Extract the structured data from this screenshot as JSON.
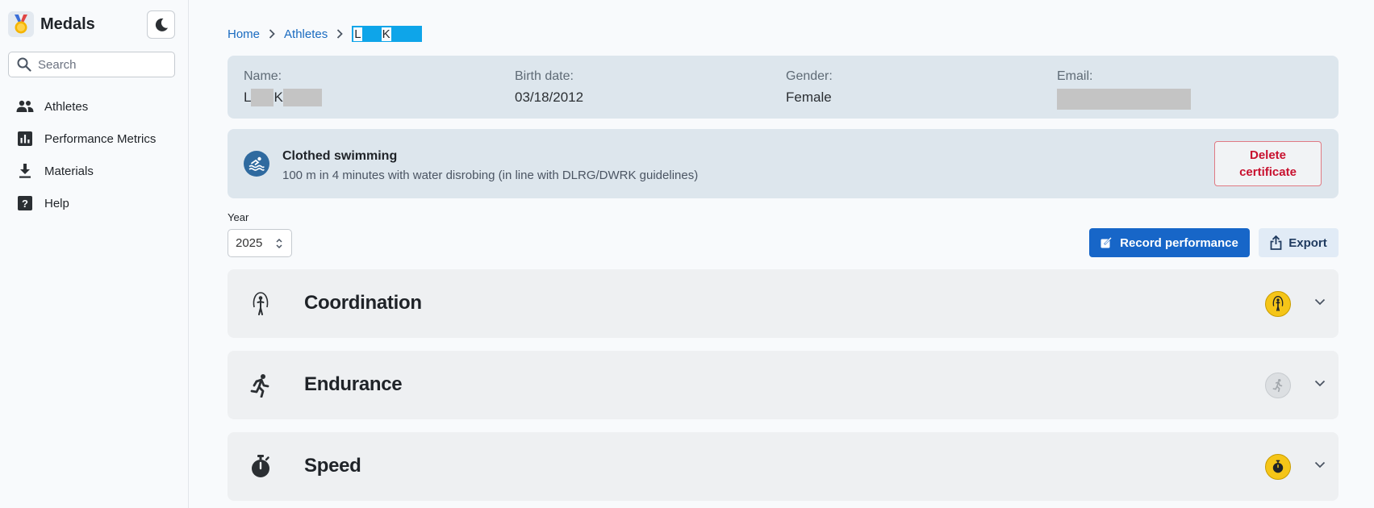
{
  "app": {
    "title": "Medals",
    "theme_toggle_icon": "moon-icon"
  },
  "search": {
    "placeholder": "Search"
  },
  "sidebar": {
    "items": [
      {
        "label": "Athletes",
        "icon": "people-icon"
      },
      {
        "label": "Performance Metrics",
        "icon": "bar-chart-icon"
      },
      {
        "label": "Materials",
        "icon": "download-icon"
      },
      {
        "label": "Help",
        "icon": "help-icon"
      }
    ]
  },
  "breadcrumb": {
    "home": "Home",
    "athletes": "Athletes",
    "current_first": "L",
    "current_second": "K"
  },
  "athlete": {
    "name_label": "Name:",
    "name_first": "L",
    "name_second": "K",
    "birth_label": "Birth date:",
    "birth_value": "03/18/2012",
    "gender_label": "Gender:",
    "gender_value": "Female",
    "email_label": "Email:"
  },
  "certificate": {
    "title": "Clothed swimming",
    "description": "100 m in 4 minutes with water disrobing (in line with DLRG/DWRK guidelines)",
    "delete_label_line1": "Delete",
    "delete_label_line2": "certificate",
    "icon": "swimming-icon"
  },
  "year": {
    "label": "Year",
    "value": "2025"
  },
  "actions": {
    "record_label": "Record performance",
    "export_label": "Export"
  },
  "disciplines": [
    {
      "title": "Coordination",
      "icon": "jump-rope-icon",
      "medal": "gold",
      "medal_color": "#f5c518"
    },
    {
      "title": "Endurance",
      "icon": "running-icon",
      "medal": "none",
      "medal_color": "#d9dcdf"
    },
    {
      "title": "Speed",
      "icon": "stopwatch-icon",
      "medal": "gold",
      "medal_color": "#f5c518"
    }
  ],
  "colors": {
    "primary": "#1766c8",
    "link": "#1a6bc0",
    "danger": "#c8102e",
    "card": "#dde6ed"
  }
}
